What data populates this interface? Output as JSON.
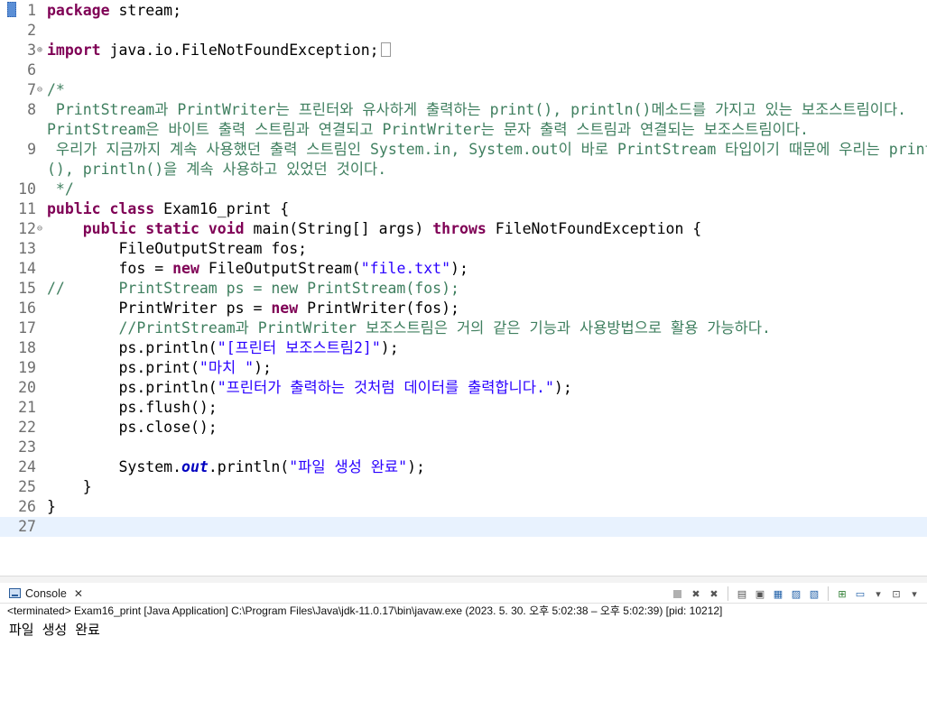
{
  "editor": {
    "lines": [
      {
        "n": "1",
        "fold": "",
        "spans": [
          {
            "t": "package",
            "c": "kw"
          },
          {
            "t": " stream;"
          }
        ]
      },
      {
        "n": "2",
        "fold": "",
        "spans": []
      },
      {
        "n": "3",
        "fold": "⊕",
        "spans": [
          {
            "t": "import",
            "c": "kw"
          },
          {
            "t": " java.io.FileNotFoundException;"
          }
        ],
        "box": true
      },
      {
        "n": "6",
        "fold": "",
        "spans": []
      },
      {
        "n": "7",
        "fold": "⊖",
        "spans": [
          {
            "t": "/*",
            "c": "cm"
          }
        ]
      },
      {
        "n": "8",
        "fold": "",
        "spans": [
          {
            "t": " PrintStream과 PrintWriter는 프린터와 유사하게 출력하는 print(), println()메소드를 가지고 있는 보조스트림이다.",
            "c": "cm"
          }
        ]
      },
      {
        "n": "",
        "fold": "",
        "spans": [
          {
            "t": "PrintStream은 바이트 출력 스트림과 연결되고 PrintWriter는 문자 출력 스트림과 연결되는 보조스트림이다.",
            "c": "cm"
          }
        ]
      },
      {
        "n": "9",
        "fold": "",
        "spans": [
          {
            "t": " 우리가 지금까지 계속 사용했던 출력 스트림인 System.in, System.out이 바로 PrintStream 타입이기 때문에 우리는 print",
            "c": "cm"
          }
        ]
      },
      {
        "n": "",
        "fold": "",
        "spans": [
          {
            "t": "(), println()을 계속 사용하고 있었던 것이다.",
            "c": "cm"
          }
        ]
      },
      {
        "n": "10",
        "fold": "",
        "spans": [
          {
            "t": " */",
            "c": "cm"
          }
        ]
      },
      {
        "n": "11",
        "fold": "",
        "spans": [
          {
            "t": "public",
            "c": "kw"
          },
          {
            "t": " "
          },
          {
            "t": "class",
            "c": "kw"
          },
          {
            "t": " Exam16_print {"
          }
        ]
      },
      {
        "n": "12",
        "fold": "⊖",
        "spans": [
          {
            "t": "    "
          },
          {
            "t": "public",
            "c": "kw"
          },
          {
            "t": " "
          },
          {
            "t": "static",
            "c": "kw"
          },
          {
            "t": " "
          },
          {
            "t": "void",
            "c": "kw"
          },
          {
            "t": " main(String[] args) "
          },
          {
            "t": "throws",
            "c": "kw"
          },
          {
            "t": " FileNotFoundException {"
          }
        ]
      },
      {
        "n": "13",
        "fold": "",
        "spans": [
          {
            "t": "        FileOutputStream fos;"
          }
        ]
      },
      {
        "n": "14",
        "fold": "",
        "spans": [
          {
            "t": "        fos = "
          },
          {
            "t": "new",
            "c": "kw"
          },
          {
            "t": " FileOutputStream("
          },
          {
            "t": "\"file.txt\"",
            "c": "str"
          },
          {
            "t": ");"
          }
        ]
      },
      {
        "n": "15",
        "fold": "",
        "spans": [
          {
            "t": "//      PrintStream ps = new PrintStream(fos);",
            "c": "cm"
          }
        ]
      },
      {
        "n": "16",
        "fold": "",
        "spans": [
          {
            "t": "        PrintWriter ps = "
          },
          {
            "t": "new",
            "c": "kw"
          },
          {
            "t": " PrintWriter(fos);"
          }
        ]
      },
      {
        "n": "17",
        "fold": "",
        "spans": [
          {
            "t": "        "
          },
          {
            "t": "//PrintStream과 PrintWriter 보조스트림은 거의 같은 기능과 사용방법으로 활용 가능하다.",
            "c": "cm"
          }
        ]
      },
      {
        "n": "18",
        "fold": "",
        "spans": [
          {
            "t": "        ps.println("
          },
          {
            "t": "\"[프린터 보조스트림2]\"",
            "c": "str"
          },
          {
            "t": ");"
          }
        ]
      },
      {
        "n": "19",
        "fold": "",
        "spans": [
          {
            "t": "        ps.print("
          },
          {
            "t": "\"마치 \"",
            "c": "str"
          },
          {
            "t": ");"
          }
        ]
      },
      {
        "n": "20",
        "fold": "",
        "spans": [
          {
            "t": "        ps.println("
          },
          {
            "t": "\"프린터가 출력하는 것처럼 데이터를 출력합니다.\"",
            "c": "str"
          },
          {
            "t": ");"
          }
        ]
      },
      {
        "n": "21",
        "fold": "",
        "spans": [
          {
            "t": "        ps.flush();"
          }
        ]
      },
      {
        "n": "22",
        "fold": "",
        "spans": [
          {
            "t": "        ps.close();"
          }
        ]
      },
      {
        "n": "23",
        "fold": "",
        "spans": []
      },
      {
        "n": "24",
        "fold": "",
        "spans": [
          {
            "t": "        System."
          },
          {
            "t": "out",
            "c": "fld"
          },
          {
            "t": ".println("
          },
          {
            "t": "\"파일 생성 완료\"",
            "c": "str"
          },
          {
            "t": ");"
          }
        ]
      },
      {
        "n": "25",
        "fold": "",
        "spans": [
          {
            "t": "    }"
          }
        ]
      },
      {
        "n": "26",
        "fold": "",
        "spans": [
          {
            "t": "}"
          }
        ]
      },
      {
        "n": "27",
        "fold": "",
        "spans": [],
        "current": true
      }
    ]
  },
  "console": {
    "tab_label": "Console",
    "close_glyph": "✕",
    "status_text": "<terminated> Exam16_print [Java Application] C:\\Program Files\\Java\\jdk-11.0.17\\bin\\javaw.exe  (2023. 5. 30. 오후 5:02:38 – 오후 5:02:39) [pid: 10212]",
    "output": "파일 생성 완료",
    "toolbar": [
      {
        "name": "terminate-icon",
        "glyph": "",
        "cls": "stop"
      },
      {
        "name": "remove-launch-icon",
        "glyph": "✖",
        "cls": ""
      },
      {
        "name": "remove-all-terminated-icon",
        "glyph": "✖",
        "cls": ""
      },
      {
        "name": "sep",
        "glyph": "",
        "cls": "sep"
      },
      {
        "name": "clear-console-icon",
        "glyph": "▤",
        "cls": ""
      },
      {
        "name": "scroll-lock-icon",
        "glyph": "▣",
        "cls": ""
      },
      {
        "name": "word-wrap-icon",
        "glyph": "▦",
        "cls": "blu"
      },
      {
        "name": "show-on-stdout-icon",
        "glyph": "▨",
        "cls": "blu"
      },
      {
        "name": "show-on-stderr-icon",
        "glyph": "▧",
        "cls": "blu"
      },
      {
        "name": "sep",
        "glyph": "",
        "cls": "sep"
      },
      {
        "name": "pin-console-icon",
        "glyph": "⊞",
        "cls": "grn"
      },
      {
        "name": "display-selected-console-icon",
        "glyph": "▭",
        "cls": "blu"
      },
      {
        "name": "chevron-down-icon",
        "glyph": "▾",
        "cls": ""
      },
      {
        "name": "open-console-icon",
        "glyph": "⊡",
        "cls": ""
      },
      {
        "name": "chevron-down-icon",
        "glyph": "▾",
        "cls": ""
      }
    ]
  },
  "colors": {
    "keyword": "#7f0055",
    "string": "#2a00ff",
    "comment": "#3f7f5f",
    "field": "#0000c0",
    "current_line": "#e8f2fe"
  }
}
